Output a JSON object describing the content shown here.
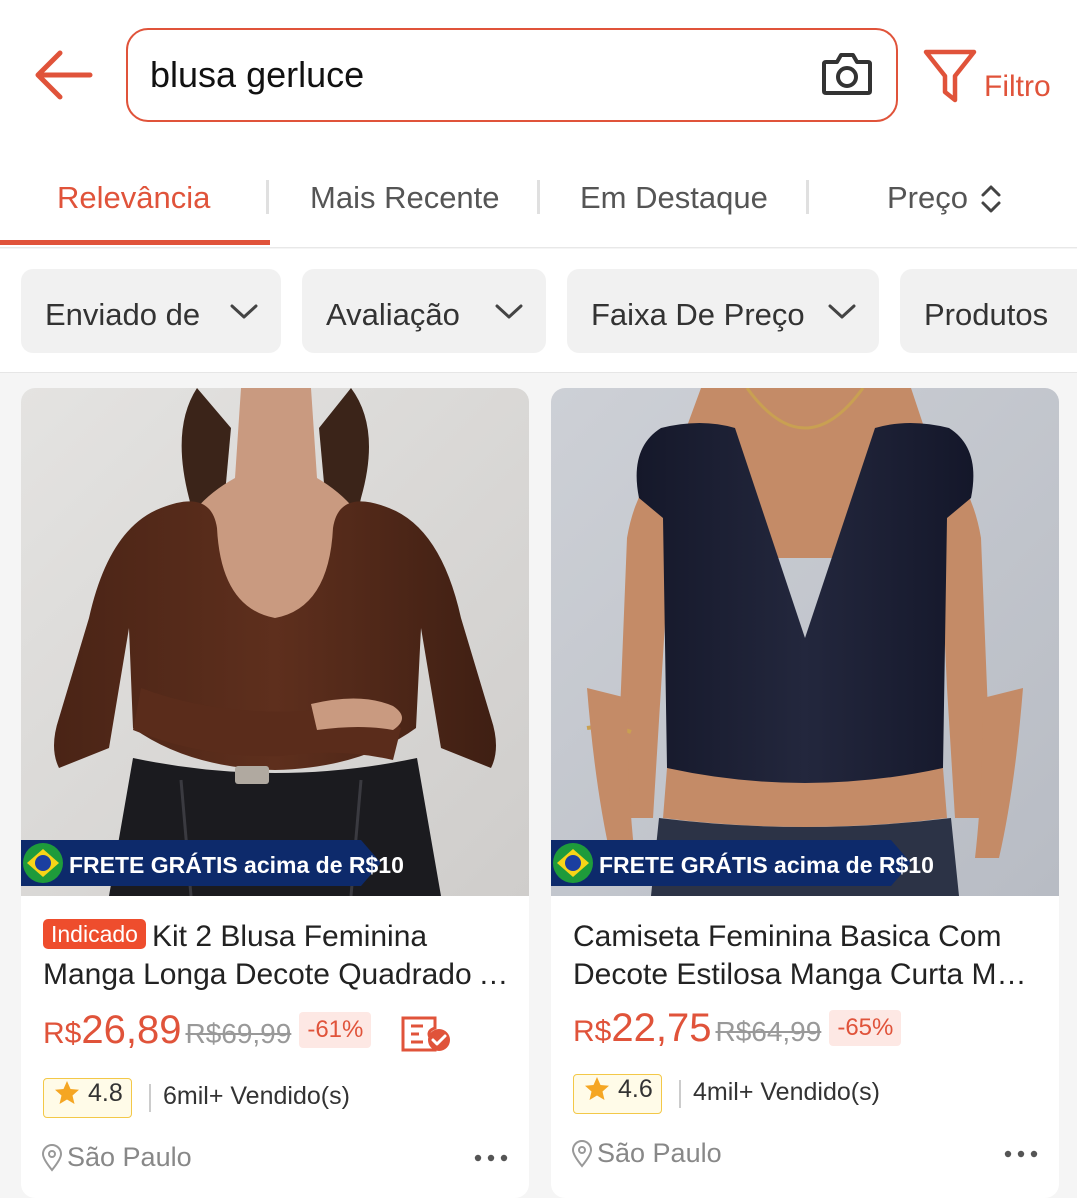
{
  "header": {
    "search_query": "blusa gerluce",
    "filter_label": "Filtro",
    "accent_color": "#e0533a"
  },
  "sort_tabs": [
    {
      "label": "Relevância",
      "active": true
    },
    {
      "label": "Mais Recente",
      "active": false
    },
    {
      "label": "Em Destaque",
      "active": false
    },
    {
      "label": "Preço",
      "active": false
    }
  ],
  "filter_chips": [
    {
      "label": "Enviado de"
    },
    {
      "label": "Avaliação"
    },
    {
      "label": "Faixa De Preço"
    },
    {
      "label": "Produtos"
    }
  ],
  "products": [
    {
      "promo": "FRETE GRÁTIS acima de R$10",
      "tag": "Indicado",
      "title_line1": "Kit 2 Blusa Feminina",
      "title_line2": "Manga Longa Decote Quadrado Ajustada Básica",
      "currency": "R$",
      "price": "26,89",
      "old_price": "R$69,99",
      "discount": "-61%",
      "rating": "4.8",
      "sold": "6mil+ Vendido(s)",
      "location": "São Paulo",
      "image_desc": "brown long sleeve square neck top"
    },
    {
      "promo": "FRETE GRÁTIS acima de R$10",
      "title_line1": "Camiseta Feminina Basica Com",
      "title_line2": "Decote Estilosa Manga Curta Moda Blogueira",
      "currency": "R$",
      "price": "22,75",
      "old_price": "R$64,99",
      "discount": "-65%",
      "rating": "4.6",
      "sold": "4mil+ Vendido(s)",
      "location": "São Paulo",
      "image_desc": "navy short sleeve deep v-neck top"
    }
  ]
}
